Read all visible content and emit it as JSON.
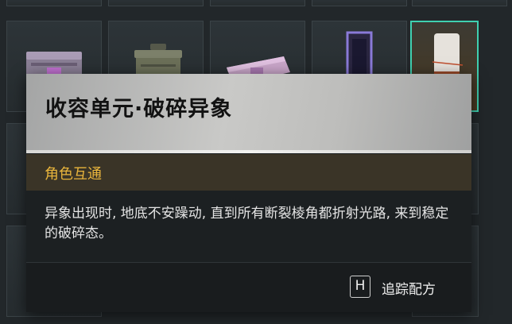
{
  "tooltip": {
    "title": "收容单元·破碎异象",
    "tag": "角色互通",
    "description": "异象出现时, 地底不安躁动, 直到所有断裂棱角都折射光路, 来到稳定的破碎态。",
    "hotkey": "H",
    "action_label": "追踪配方"
  },
  "colors": {
    "selected_border": "#3fd0b0",
    "tag_text": "#e8b43c",
    "tag_bar": "#3a3427"
  }
}
